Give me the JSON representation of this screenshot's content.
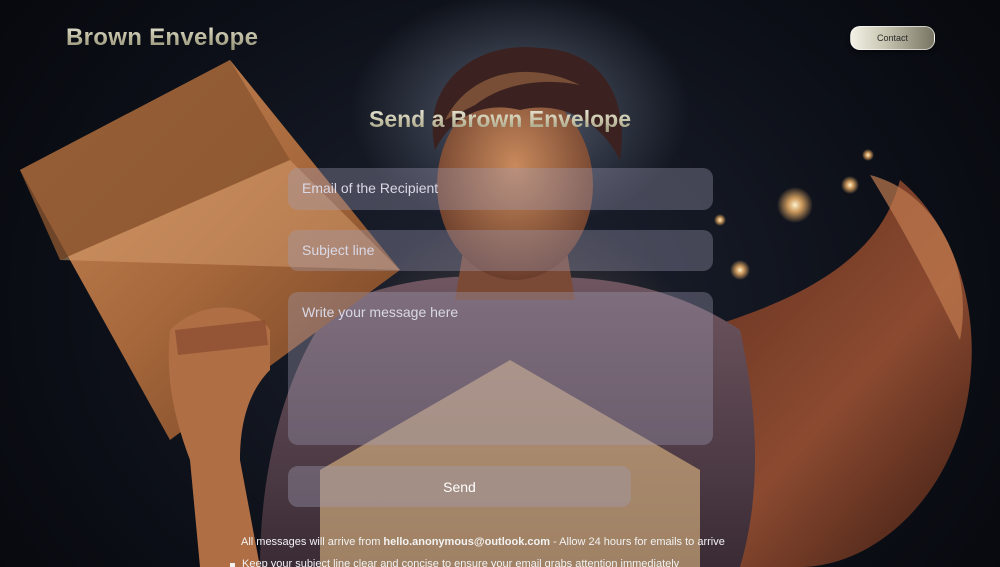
{
  "header": {
    "logo_text": "Brown Envelope",
    "contact_label": "Contact"
  },
  "form": {
    "title": "Send a Brown Envelope",
    "email_placeholder": "Email of the Recipient",
    "subject_placeholder": "Subject line",
    "message_placeholder": "Write your message here",
    "send_label": "Send"
  },
  "footer": {
    "notice_prefix": "All messages will arrive from ",
    "notice_email": "hello.anonymous@outlook.com",
    "notice_suffix": " - Allow 24 hours for emails to arrive",
    "tip": "Keep your subject line clear and concise to ensure your email grabs attention immediately"
  },
  "background": {
    "description_icon": "hero-with-envelope-illustration",
    "accent": "#c98a4e",
    "glow": "#ffd696"
  }
}
